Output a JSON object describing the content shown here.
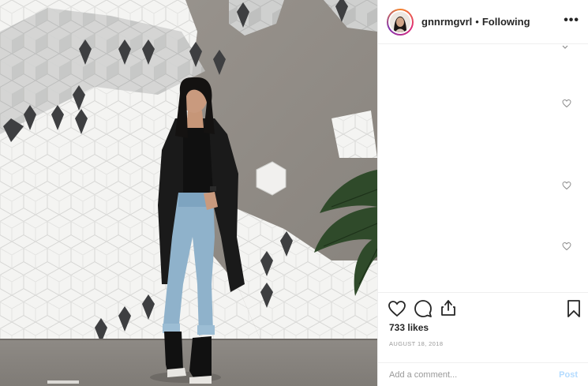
{
  "post": {
    "username": "gnnrmgvrl",
    "separator": "•",
    "follow_status": "Following",
    "more_label": "•••",
    "likes": "733 likes",
    "date": "AUGUST 18, 2018",
    "comment_placeholder": "Add a comment...",
    "post_label": "Post"
  },
  "icons": {
    "like": "heart-icon",
    "comment": "comment-icon",
    "share": "share-icon",
    "save": "bookmark-icon",
    "comment_like": "heart-icon"
  },
  "colors": {
    "text": "#262626",
    "muted": "#999999",
    "divider": "#efefef",
    "post_disabled": "#b3dbff"
  }
}
